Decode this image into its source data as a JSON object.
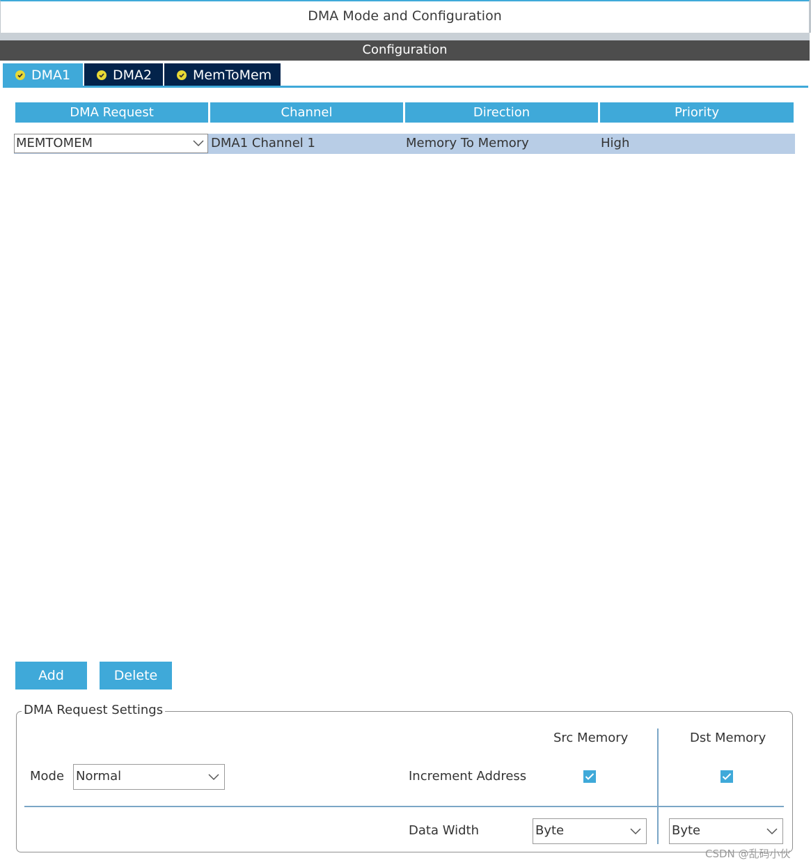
{
  "window": {
    "title": "DMA Mode and Configuration"
  },
  "config_bar": {
    "label": "Configuration"
  },
  "tabs": [
    {
      "label": "DMA1",
      "active": true,
      "status_icon": "check-circle-icon"
    },
    {
      "label": "DMA2",
      "active": false,
      "status_icon": "check-circle-icon"
    },
    {
      "label": "MemToMem",
      "active": false,
      "status_icon": "check-circle-icon"
    }
  ],
  "table": {
    "headers": [
      "DMA Request",
      "Channel",
      "Direction",
      "Priority"
    ],
    "rows": [
      {
        "request": "MEMTOMEM",
        "channel": "DMA1 Channel 1",
        "direction": "Memory To Memory",
        "priority": "High"
      }
    ]
  },
  "buttons": {
    "add": "Add",
    "delete": "Delete"
  },
  "settings": {
    "legend": "DMA Request Settings",
    "mode_label": "Mode",
    "mode_value": "Normal",
    "src_header": "Src Memory",
    "dst_header": "Dst Memory",
    "increment_label": "Increment Address",
    "src_increment": true,
    "dst_increment": true,
    "data_width_label": "Data Width",
    "src_width": "Byte",
    "dst_width": "Byte"
  },
  "watermark": "CSDN @乱码小伙",
  "colors": {
    "accent": "#3fa9d9",
    "tab_inactive": "#03234b",
    "row_selected": "#b8cde6",
    "config_bar": "#4d4d4d",
    "status_icon": "#e8d936"
  }
}
